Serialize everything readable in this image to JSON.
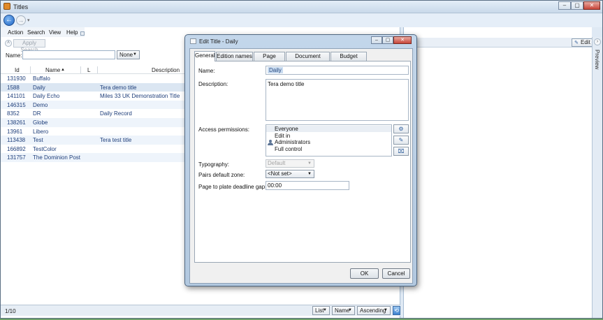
{
  "window": {
    "title": "Titles",
    "min_glyph": "–",
    "max_glyph": "▢",
    "close_glyph": "✕"
  },
  "nav": {
    "back_glyph": "←",
    "forward_glyph": "→",
    "dropdown_glyph": "▾"
  },
  "menu": {
    "items": [
      "Action",
      "Search",
      "View",
      "Help"
    ]
  },
  "search": {
    "apply_label": "Apply Search",
    "collapse_glyph": "˄",
    "name_label": "Name:",
    "name_value": "",
    "match_mode": "None"
  },
  "grid": {
    "columns": {
      "id": "Id",
      "name": "Name",
      "l": "L",
      "description": "Description"
    },
    "sort_glyph": "▲",
    "rows": [
      {
        "id": "131930",
        "name": "Buffalo",
        "description": ""
      },
      {
        "id": "1588",
        "name": "Daily",
        "description": "Tera demo title"
      },
      {
        "id": "141101",
        "name": "Daily Echo",
        "description": "Miles 33 UK Demonstration Title"
      },
      {
        "id": "146315",
        "name": "Demo",
        "description": ""
      },
      {
        "id": "8352",
        "name": "DR",
        "description": "Daily Record"
      },
      {
        "id": "138261",
        "name": "Globe",
        "description": ""
      },
      {
        "id": "13961",
        "name": "Libero",
        "description": ""
      },
      {
        "id": "113438",
        "name": "Test",
        "description": "Tera test title"
      },
      {
        "id": "166892",
        "name": "TestColor",
        "description": ""
      },
      {
        "id": "131757",
        "name": "The Dominion Post",
        "description": ""
      }
    ]
  },
  "status": {
    "count": "1/10",
    "view_mode": "List",
    "sort_field": "Name",
    "sort_order": "Ascending",
    "refresh_glyph": "⟲"
  },
  "right_pane": {
    "edit_label": "Edit",
    "edit_icon": "pencil-icon",
    "preview_label": "Preview",
    "chevron_glyph": "›"
  },
  "dialog": {
    "title": "Edit Title - Daily",
    "tabs": [
      "General",
      "Edition names",
      "Page names",
      "Document names",
      "Budget names"
    ],
    "active_tab": "General",
    "fields": {
      "name_label": "Name:",
      "name_value": "Daily",
      "description_label": "Description:",
      "description_value": "Tera demo title",
      "access_label": "Access permissions:",
      "permissions": [
        {
          "group": "Everyone",
          "right": "Edit in"
        },
        {
          "group": "Administrators",
          "right": "Full control"
        }
      ],
      "permission_buttons": [
        "⚙",
        "✎",
        "⌧"
      ],
      "typography_label": "Typography:",
      "typography_value": "Default",
      "pairs_label": "Pairs default zone:",
      "pairs_value": "<Not set>",
      "deadline_label": "Page to plate deadline gap:",
      "deadline_value": "00:00"
    },
    "ok_label": "OK",
    "cancel_label": "Cancel"
  },
  "colors": {
    "accent": "#1c63c4",
    "link_text": "#1e3e7a",
    "selection": "#c8dbf0"
  }
}
